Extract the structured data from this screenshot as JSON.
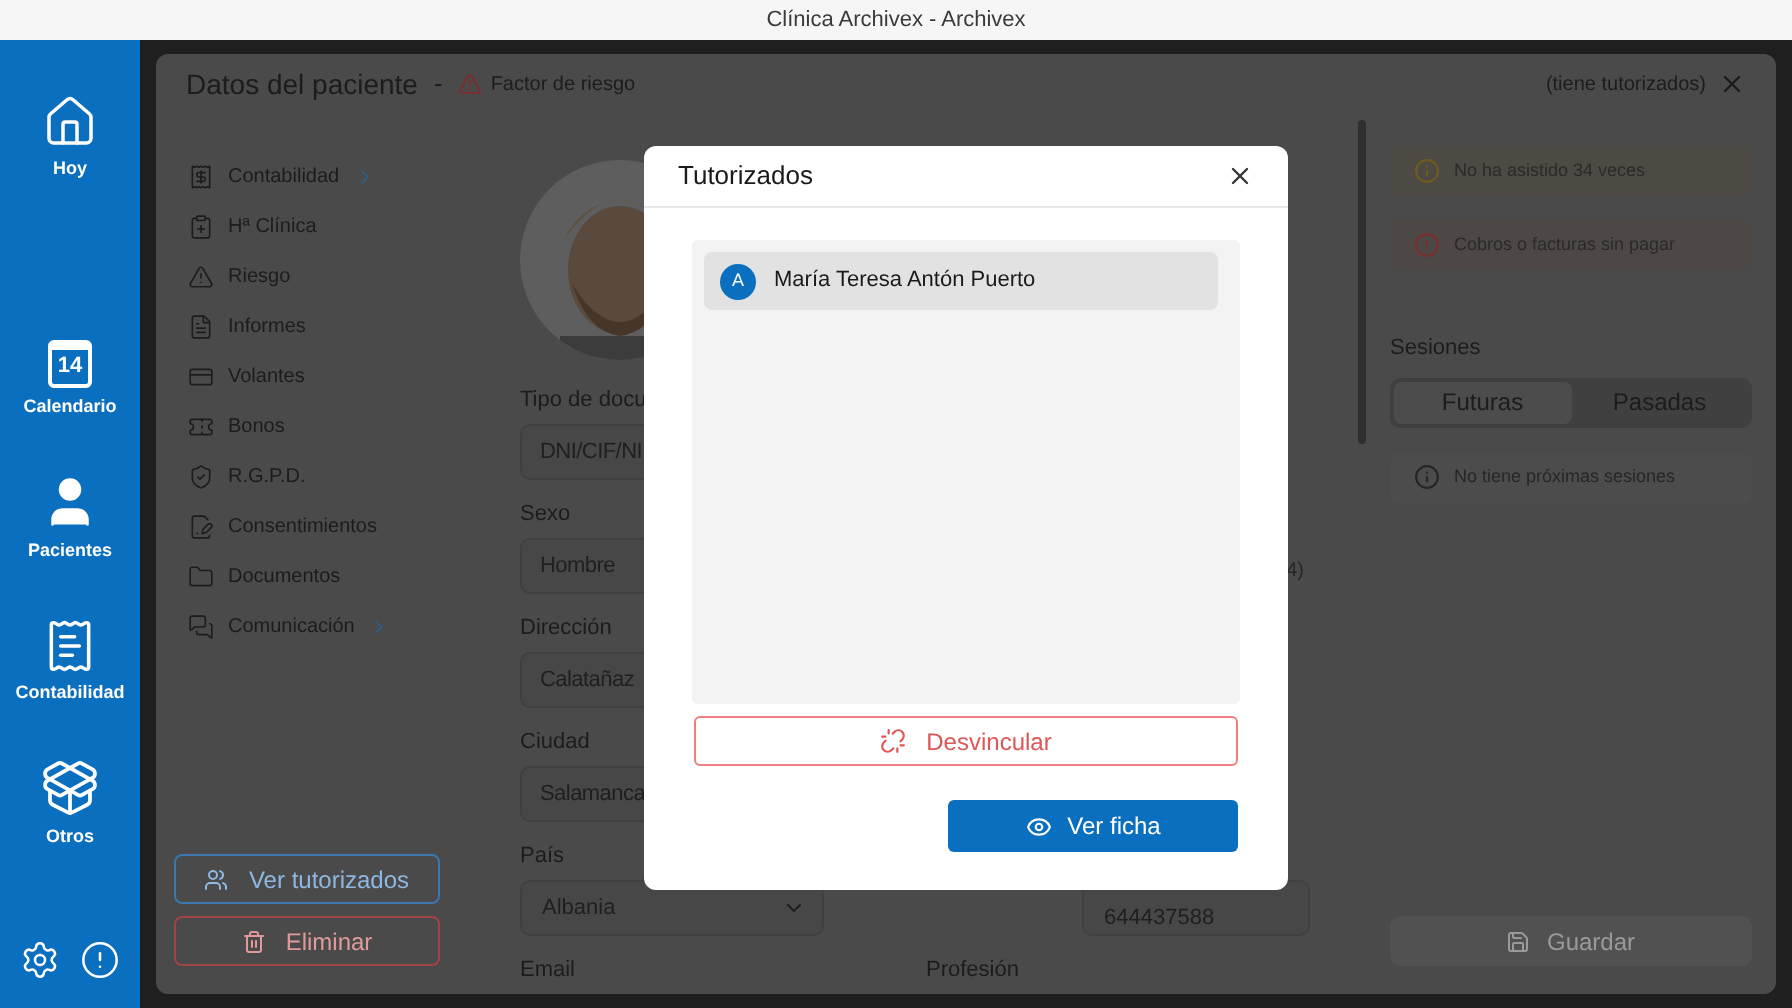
{
  "title_bar": {
    "title": "Clínica Archivex - Archivex"
  },
  "nav": {
    "items": [
      {
        "label": "Hoy",
        "kind": "home"
      },
      {
        "label": "Calendario",
        "kind": "calendar",
        "day": "14"
      },
      {
        "label": "Pacientes",
        "kind": "user"
      },
      {
        "label": "Contabilidad",
        "kind": "invoice"
      },
      {
        "label": "Otros",
        "kind": "box"
      }
    ]
  },
  "panel": {
    "title": "Datos del paciente",
    "separator": "-",
    "risk_label": "Factor de riesgo",
    "tutor_note": "(tiene tutorizados)",
    "menu": [
      {
        "label": "Contabilidad",
        "kind": "receipt",
        "has_submenu": true
      },
      {
        "label": "Hª Clínica",
        "kind": "clinical",
        "has_submenu": false
      },
      {
        "label": "Riesgo",
        "kind": "warning",
        "has_submenu": false
      },
      {
        "label": "Informes",
        "kind": "report",
        "has_submenu": false
      },
      {
        "label": "Volantes",
        "kind": "card",
        "has_submenu": false
      },
      {
        "label": "Bonos",
        "kind": "ticket",
        "has_submenu": false
      },
      {
        "label": "R.G.P.D.",
        "kind": "shield",
        "has_submenu": false
      },
      {
        "label": "Consentimientos",
        "kind": "sign",
        "has_submenu": false
      },
      {
        "label": "Documentos",
        "kind": "folder",
        "has_submenu": false
      },
      {
        "label": "Comunicación",
        "kind": "chat",
        "has_submenu": true
      }
    ],
    "actions": [
      {
        "label": "Ver tutorizados",
        "kind": "primary"
      },
      {
        "label": "Eliminar",
        "kind": "danger"
      }
    ],
    "form": {
      "rows": [
        {
          "left": {
            "label": "Tipo de docu",
            "value": "DNI/CIF/NI",
            "kind": "text"
          }
        },
        {
          "left": {
            "label": "Sexo",
            "value": "Hombre",
            "kind": "text"
          },
          "right": {
            "value": "4)",
            "kind": "fragment"
          }
        },
        {
          "left": {
            "label": "Dirección",
            "value": "Calatañaz",
            "kind": "text"
          }
        },
        {
          "left": {
            "label": "Ciudad",
            "value": "Salamanca",
            "kind": "text"
          }
        },
        {
          "left": {
            "label": "País",
            "value": "Albania",
            "kind": "select"
          },
          "right": {
            "value": "644437588",
            "kind": "phone"
          }
        },
        {
          "left": {
            "label": "Email",
            "kind": "text"
          },
          "right": {
            "label": "Profesión",
            "kind": "text"
          }
        }
      ]
    },
    "alerts": [
      {
        "text": "No ha asistido 34 veces",
        "kind": "warning"
      },
      {
        "text": "Cobros o facturas sin pagar",
        "kind": "error"
      }
    ],
    "sessions": {
      "title": "Sesiones",
      "tabs": [
        {
          "label": "Futuras",
          "selected": true
        },
        {
          "label": "Pasadas",
          "selected": false
        }
      ],
      "empty": "No tiene próximas sesiones"
    },
    "save_button": {
      "label": "Guardar",
      "disabled": true
    }
  },
  "modal": {
    "title": "Tutorizados",
    "items": [
      {
        "initial": "A",
        "name": "María Teresa Antón Puerto",
        "selected": true
      }
    ],
    "unlink_button": "Desvincular",
    "view_button": "Ver ficha"
  }
}
